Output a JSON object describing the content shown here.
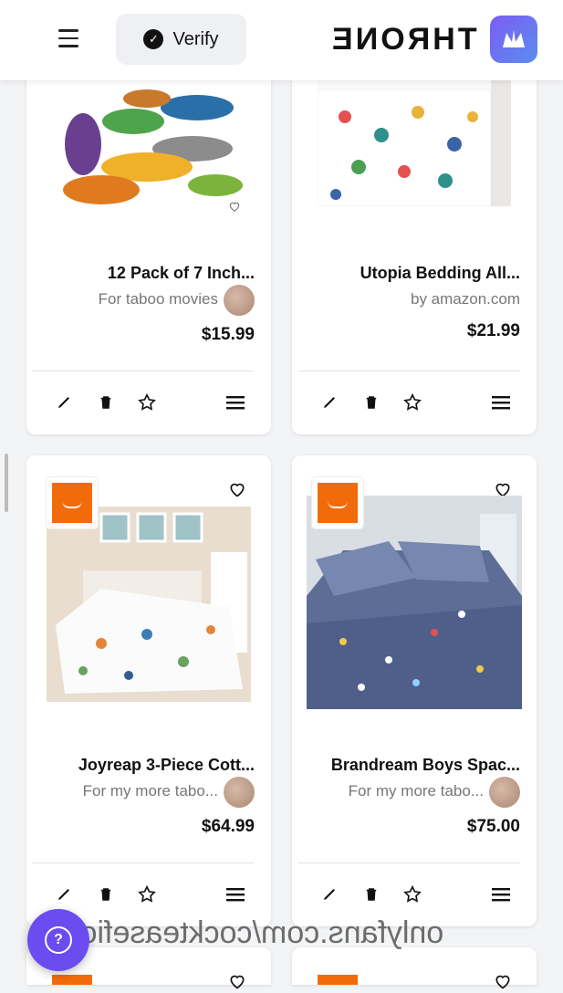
{
  "header": {
    "brand": "THRONE",
    "verify_label": "Verify"
  },
  "products": [
    {
      "title": "12 Pack of 7 Inch...",
      "subtitle": "For taboo movies",
      "price": "$15.99",
      "image": "dinosaur-toys"
    },
    {
      "title": "Utopia Bedding All...",
      "subtitle": "by amazon.com",
      "price": "$21.99",
      "image": "dinosaur-bedding"
    },
    {
      "title": "Joyreap 3-Piece Cott...",
      "subtitle": "For my more tabo...",
      "price": "$64.99",
      "image": "dinosaur-quilt-bedroom"
    },
    {
      "title": "Brandream Boys Spac...",
      "subtitle": "For my more tabo...",
      "price": "$75.00",
      "image": "space-comforter"
    }
  ],
  "watermark": "onlyfans.com/cockteasefiona",
  "colors": {
    "accent": "#6a4cf0",
    "amazon_badge": "#f26b0a"
  }
}
